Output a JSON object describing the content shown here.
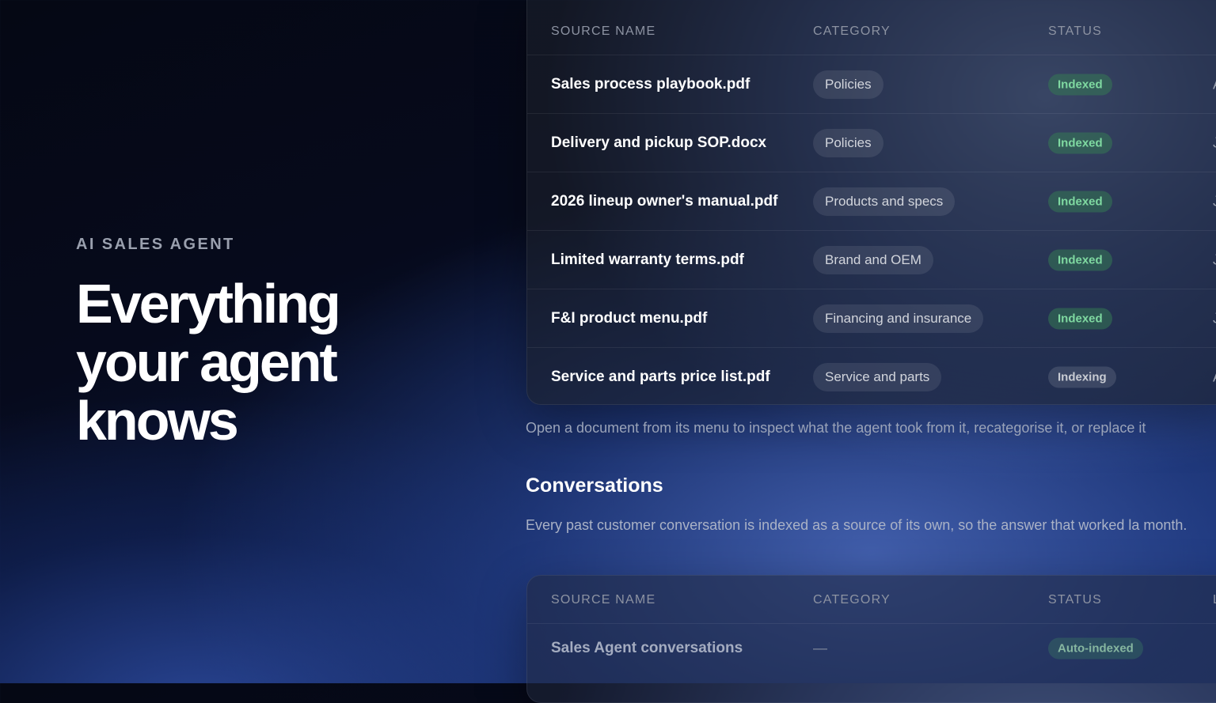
{
  "hero": {
    "eyebrow": "AI SALES AGENT",
    "headline_lines": [
      "Everything",
      "your agent",
      "knows"
    ]
  },
  "table": {
    "headers": [
      "SOURCE NAME",
      "CATEGORY",
      "STATUS"
    ],
    "rows": [
      {
        "name": "Sales process playbook.pdf",
        "category": "Policies",
        "status": "Indexed",
        "tail": "A"
      },
      {
        "name": "Delivery and pickup SOP.docx",
        "category": "Policies",
        "status": "Indexed",
        "tail": "J"
      },
      {
        "name": "2026 lineup owner's manual.pdf",
        "category": "Products and specs",
        "status": "Indexed",
        "tail": "J"
      },
      {
        "name": "Limited warranty terms.pdf",
        "category": "Brand and OEM",
        "status": "Indexed",
        "tail": "J"
      },
      {
        "name": "F&I product menu.pdf",
        "category": "Financing and insurance",
        "status": "Indexed",
        "tail": "J"
      },
      {
        "name": "Service and parts price list.pdf",
        "category": "Service and parts",
        "status": "Indexing",
        "tail": "A"
      }
    ]
  },
  "note": "Open a document from its menu to inspect what the agent took from it, recategorise it, or replace it",
  "conversations": {
    "title": "Conversations",
    "description": "Every past customer conversation is indexed as a source of its own, so the answer that worked la month."
  },
  "conv_table": {
    "headers": [
      "SOURCE NAME",
      "CATEGORY",
      "STATUS",
      "L"
    ],
    "row": {
      "name": "Sales Agent conversations",
      "category": "—",
      "status": "Auto-indexed"
    }
  }
}
